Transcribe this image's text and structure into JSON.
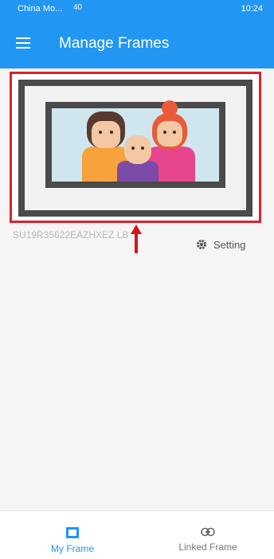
{
  "status_bar": {
    "carrier": "China Mo...",
    "signal_text": "40",
    "right_text": "10:24"
  },
  "app_bar": {
    "title": "Manage Frames",
    "menu_icon": "hamburger-icon"
  },
  "frame": {
    "serial": "SU19R35622EAZHXEZ   LB",
    "setting_label": "Setting",
    "setting_icon": "gear-icon"
  },
  "bottom_nav": {
    "items": [
      {
        "label": "My Frame",
        "icon": "frame-icon",
        "active": true
      },
      {
        "label": "Linked Frame",
        "icon": "link-icon",
        "active": false
      }
    ]
  },
  "colors": {
    "primary": "#2196f3",
    "highlight": "#e0202a"
  }
}
